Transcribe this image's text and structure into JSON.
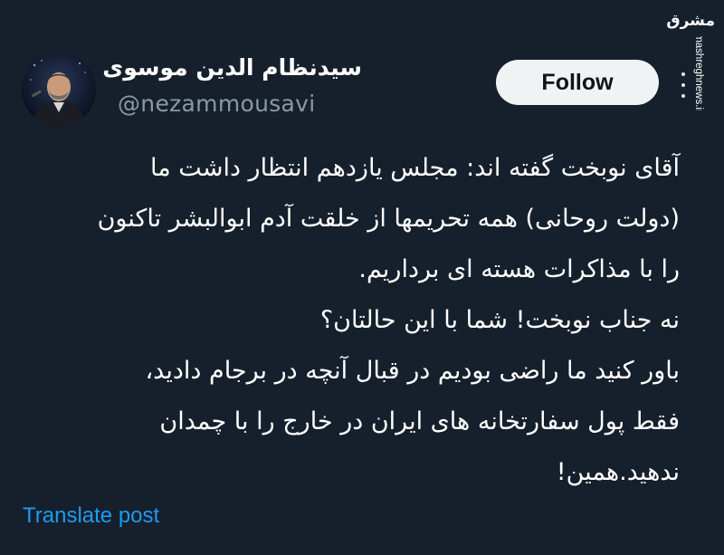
{
  "account": {
    "display_name": "سیدنظام الدین موسوی",
    "handle": "@nezammousavi"
  },
  "actions": {
    "follow_label": "Follow",
    "more_icon": "more-horizontal-icon",
    "translate_label": "Translate post"
  },
  "tweet": {
    "lines": [
      "آقای نوبخت گفته اند: مجلس یازدهم انتظار داشت ما",
      "(دولت روحانی) همه تحریمها از خلقت آدم ابوالبشر تاکنون",
      "را با مذاکرات هسته ای برداریم.",
      "نه جناب نوبخت! شما با این حالتان؟",
      "باور کنید ما راضی بودیم در قبال آنچه در برجام دادید،",
      "فقط پول سفارتخانه های ایران در خارج را با چمدان",
      "ندهید.همین!"
    ]
  },
  "watermark": {
    "logo_text": "مشرق",
    "url": "mashreghnews.ir"
  },
  "colors": {
    "background": "#16202c",
    "text_primary": "#ffffff",
    "text_secondary": "#8b98a5",
    "link": "#1d9bf0",
    "button_bg": "#eff3f4",
    "button_text": "#0f1419"
  }
}
